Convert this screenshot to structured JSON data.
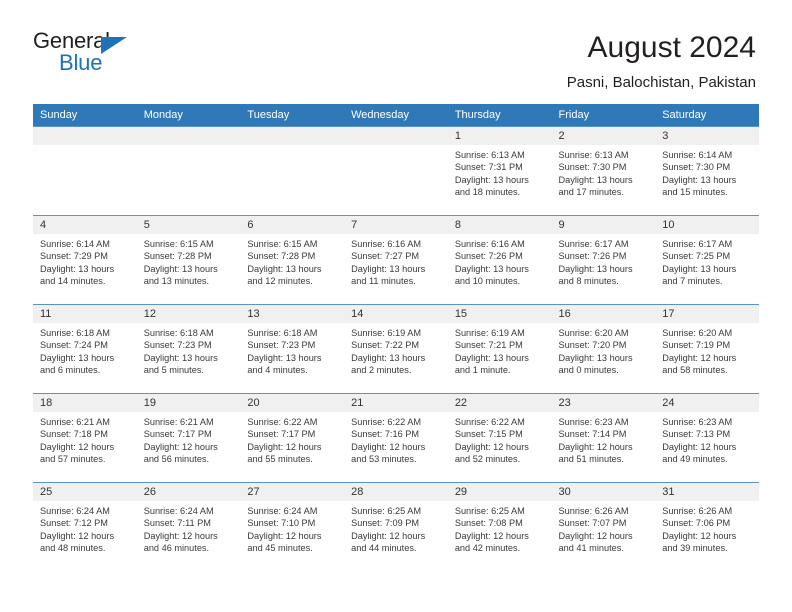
{
  "brand": {
    "name_part1": "General",
    "name_part2": "Blue",
    "accent_color": "#1d72b8"
  },
  "header": {
    "title": "August 2024",
    "subtitle": "Pasni, Balochistan, Pakistan"
  },
  "calendar": {
    "header_bg": "#3079b8",
    "daynum_bg": "#f0f0f0",
    "weekday_headers": [
      "Sunday",
      "Monday",
      "Tuesday",
      "Wednesday",
      "Thursday",
      "Friday",
      "Saturday"
    ],
    "weeks": [
      [
        {
          "day": "",
          "blank": true
        },
        {
          "day": "",
          "blank": true
        },
        {
          "day": "",
          "blank": true
        },
        {
          "day": "",
          "blank": true
        },
        {
          "day": "1",
          "sunrise": "Sunrise: 6:13 AM",
          "sunset": "Sunset: 7:31 PM",
          "daylight_1": "Daylight: 13 hours",
          "daylight_2": "and 18 minutes."
        },
        {
          "day": "2",
          "sunrise": "Sunrise: 6:13 AM",
          "sunset": "Sunset: 7:30 PM",
          "daylight_1": "Daylight: 13 hours",
          "daylight_2": "and 17 minutes."
        },
        {
          "day": "3",
          "sunrise": "Sunrise: 6:14 AM",
          "sunset": "Sunset: 7:30 PM",
          "daylight_1": "Daylight: 13 hours",
          "daylight_2": "and 15 minutes."
        }
      ],
      [
        {
          "day": "4",
          "sunrise": "Sunrise: 6:14 AM",
          "sunset": "Sunset: 7:29 PM",
          "daylight_1": "Daylight: 13 hours",
          "daylight_2": "and 14 minutes."
        },
        {
          "day": "5",
          "sunrise": "Sunrise: 6:15 AM",
          "sunset": "Sunset: 7:28 PM",
          "daylight_1": "Daylight: 13 hours",
          "daylight_2": "and 13 minutes."
        },
        {
          "day": "6",
          "sunrise": "Sunrise: 6:15 AM",
          "sunset": "Sunset: 7:28 PM",
          "daylight_1": "Daylight: 13 hours",
          "daylight_2": "and 12 minutes."
        },
        {
          "day": "7",
          "sunrise": "Sunrise: 6:16 AM",
          "sunset": "Sunset: 7:27 PM",
          "daylight_1": "Daylight: 13 hours",
          "daylight_2": "and 11 minutes."
        },
        {
          "day": "8",
          "sunrise": "Sunrise: 6:16 AM",
          "sunset": "Sunset: 7:26 PM",
          "daylight_1": "Daylight: 13 hours",
          "daylight_2": "and 10 minutes."
        },
        {
          "day": "9",
          "sunrise": "Sunrise: 6:17 AM",
          "sunset": "Sunset: 7:26 PM",
          "daylight_1": "Daylight: 13 hours",
          "daylight_2": "and 8 minutes."
        },
        {
          "day": "10",
          "sunrise": "Sunrise: 6:17 AM",
          "sunset": "Sunset: 7:25 PM",
          "daylight_1": "Daylight: 13 hours",
          "daylight_2": "and 7 minutes."
        }
      ],
      [
        {
          "day": "11",
          "sunrise": "Sunrise: 6:18 AM",
          "sunset": "Sunset: 7:24 PM",
          "daylight_1": "Daylight: 13 hours",
          "daylight_2": "and 6 minutes."
        },
        {
          "day": "12",
          "sunrise": "Sunrise: 6:18 AM",
          "sunset": "Sunset: 7:23 PM",
          "daylight_1": "Daylight: 13 hours",
          "daylight_2": "and 5 minutes."
        },
        {
          "day": "13",
          "sunrise": "Sunrise: 6:18 AM",
          "sunset": "Sunset: 7:23 PM",
          "daylight_1": "Daylight: 13 hours",
          "daylight_2": "and 4 minutes."
        },
        {
          "day": "14",
          "sunrise": "Sunrise: 6:19 AM",
          "sunset": "Sunset: 7:22 PM",
          "daylight_1": "Daylight: 13 hours",
          "daylight_2": "and 2 minutes."
        },
        {
          "day": "15",
          "sunrise": "Sunrise: 6:19 AM",
          "sunset": "Sunset: 7:21 PM",
          "daylight_1": "Daylight: 13 hours",
          "daylight_2": "and 1 minute."
        },
        {
          "day": "16",
          "sunrise": "Sunrise: 6:20 AM",
          "sunset": "Sunset: 7:20 PM",
          "daylight_1": "Daylight: 13 hours",
          "daylight_2": "and 0 minutes."
        },
        {
          "day": "17",
          "sunrise": "Sunrise: 6:20 AM",
          "sunset": "Sunset: 7:19 PM",
          "daylight_1": "Daylight: 12 hours",
          "daylight_2": "and 58 minutes."
        }
      ],
      [
        {
          "day": "18",
          "sunrise": "Sunrise: 6:21 AM",
          "sunset": "Sunset: 7:18 PM",
          "daylight_1": "Daylight: 12 hours",
          "daylight_2": "and 57 minutes."
        },
        {
          "day": "19",
          "sunrise": "Sunrise: 6:21 AM",
          "sunset": "Sunset: 7:17 PM",
          "daylight_1": "Daylight: 12 hours",
          "daylight_2": "and 56 minutes."
        },
        {
          "day": "20",
          "sunrise": "Sunrise: 6:22 AM",
          "sunset": "Sunset: 7:17 PM",
          "daylight_1": "Daylight: 12 hours",
          "daylight_2": "and 55 minutes."
        },
        {
          "day": "21",
          "sunrise": "Sunrise: 6:22 AM",
          "sunset": "Sunset: 7:16 PM",
          "daylight_1": "Daylight: 12 hours",
          "daylight_2": "and 53 minutes."
        },
        {
          "day": "22",
          "sunrise": "Sunrise: 6:22 AM",
          "sunset": "Sunset: 7:15 PM",
          "daylight_1": "Daylight: 12 hours",
          "daylight_2": "and 52 minutes."
        },
        {
          "day": "23",
          "sunrise": "Sunrise: 6:23 AM",
          "sunset": "Sunset: 7:14 PM",
          "daylight_1": "Daylight: 12 hours",
          "daylight_2": "and 51 minutes."
        },
        {
          "day": "24",
          "sunrise": "Sunrise: 6:23 AM",
          "sunset": "Sunset: 7:13 PM",
          "daylight_1": "Daylight: 12 hours",
          "daylight_2": "and 49 minutes."
        }
      ],
      [
        {
          "day": "25",
          "sunrise": "Sunrise: 6:24 AM",
          "sunset": "Sunset: 7:12 PM",
          "daylight_1": "Daylight: 12 hours",
          "daylight_2": "and 48 minutes."
        },
        {
          "day": "26",
          "sunrise": "Sunrise: 6:24 AM",
          "sunset": "Sunset: 7:11 PM",
          "daylight_1": "Daylight: 12 hours",
          "daylight_2": "and 46 minutes."
        },
        {
          "day": "27",
          "sunrise": "Sunrise: 6:24 AM",
          "sunset": "Sunset: 7:10 PM",
          "daylight_1": "Daylight: 12 hours",
          "daylight_2": "and 45 minutes."
        },
        {
          "day": "28",
          "sunrise": "Sunrise: 6:25 AM",
          "sunset": "Sunset: 7:09 PM",
          "daylight_1": "Daylight: 12 hours",
          "daylight_2": "and 44 minutes."
        },
        {
          "day": "29",
          "sunrise": "Sunrise: 6:25 AM",
          "sunset": "Sunset: 7:08 PM",
          "daylight_1": "Daylight: 12 hours",
          "daylight_2": "and 42 minutes."
        },
        {
          "day": "30",
          "sunrise": "Sunrise: 6:26 AM",
          "sunset": "Sunset: 7:07 PM",
          "daylight_1": "Daylight: 12 hours",
          "daylight_2": "and 41 minutes."
        },
        {
          "day": "31",
          "sunrise": "Sunrise: 6:26 AM",
          "sunset": "Sunset: 7:06 PM",
          "daylight_1": "Daylight: 12 hours",
          "daylight_2": "and 39 minutes."
        }
      ]
    ]
  }
}
